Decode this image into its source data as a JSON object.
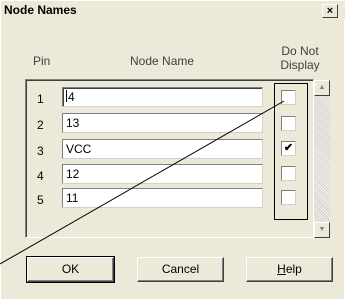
{
  "window": {
    "title": "Node Names",
    "close_glyph": "×"
  },
  "headers": {
    "pin": "Pin",
    "node_name": "Node Name",
    "do_not_display_line1": "Do Not",
    "do_not_display_line2": "Display"
  },
  "rows": [
    {
      "pin": "1",
      "node_name": "4",
      "do_not_display": false
    },
    {
      "pin": "2",
      "node_name": "13",
      "do_not_display": false
    },
    {
      "pin": "3",
      "node_name": "VCC",
      "do_not_display": true
    },
    {
      "pin": "4",
      "node_name": "12",
      "do_not_display": false
    },
    {
      "pin": "5",
      "node_name": "11",
      "do_not_display": false
    }
  ],
  "scrollbar": {
    "up_icon": "scroll-up-arrow",
    "down_icon": "scroll-down-arrow"
  },
  "buttons": {
    "ok": "OK",
    "cancel": "Cancel",
    "help_prefix": "H",
    "help_rest": "elp"
  },
  "check_glyph": "✔"
}
